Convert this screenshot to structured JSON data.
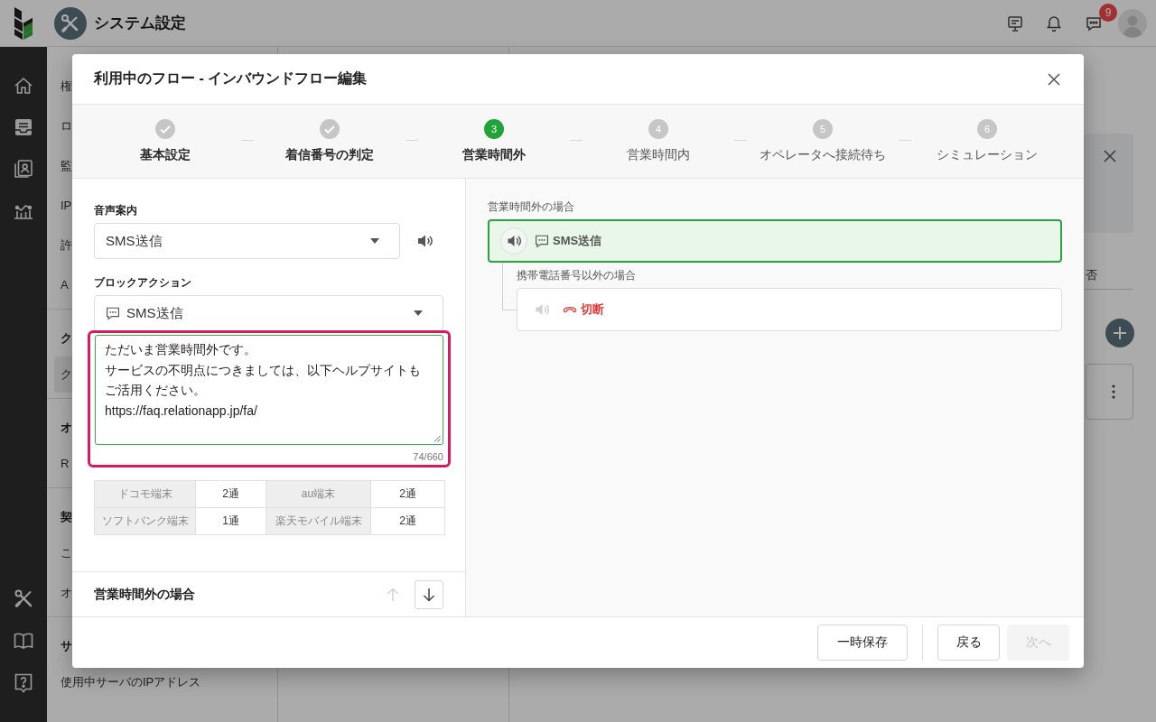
{
  "header": {
    "title": "システム設定",
    "badge": "9"
  },
  "settings_menu": {
    "items": [
      {
        "label": "権",
        "selected": false
      },
      {
        "label": "ロ",
        "selected": false
      },
      {
        "label": "監",
        "selected": false
      },
      {
        "label": "IP",
        "selected": false
      },
      {
        "label": "許",
        "selected": false
      },
      {
        "label": "A",
        "selected": false
      }
    ],
    "groups": [
      {
        "heading": "ク",
        "items": [
          {
            "label": "ク",
            "selected": true
          }
        ]
      },
      {
        "heading": "オ",
        "items": [
          {
            "label": "R",
            "selected": false
          }
        ]
      },
      {
        "heading": "契",
        "items": [
          {
            "label": "こ",
            "selected": false
          },
          {
            "label": "オ",
            "selected": false
          }
        ]
      },
      {
        "heading": "サ",
        "items": [
          {
            "label": "使用中サーバのIPアドレス",
            "selected": false
          }
        ]
      }
    ]
  },
  "background_tab": {
    "label": "否"
  },
  "dialog": {
    "title": "利用中のフロー - インバウンドフロー編集",
    "steps": [
      {
        "label": "基本設定",
        "done": true,
        "selected": false
      },
      {
        "label": "着信番号の判定",
        "done": true,
        "selected": false
      },
      {
        "label": "営業時間外",
        "done": false,
        "selected": true,
        "number": "3"
      },
      {
        "label": "営業時間内",
        "done": false,
        "selected": false,
        "number": "4"
      },
      {
        "label": "オペレータへ接続待ち",
        "done": false,
        "selected": false,
        "number": "5"
      },
      {
        "label": "シミュレーション",
        "done": false,
        "selected": false,
        "number": "6"
      }
    ],
    "form": {
      "voice_label": "音声案内",
      "voice_value": "SMS送信",
      "action_label": "ブロックアクション",
      "action_value": "SMS送信",
      "message_lines": [
        "ただいま営業時間外です。",
        "サービスの不明点につきましては、以下ヘルプサイトもご活用ください。",
        "https://faq.relationapp.jp/fa/"
      ],
      "char_count": "74/660",
      "highlighted": true,
      "carrier_counts": [
        {
          "carrier": "ドコモ端末",
          "count": "2通"
        },
        {
          "carrier": "au端末",
          "count": "2通"
        },
        {
          "carrier": "ソフトバンク端末",
          "count": "1通"
        },
        {
          "carrier": "楽天モバイル端末",
          "count": "2通"
        }
      ],
      "section": {
        "title": "営業時間外の場合",
        "controls": [
          {
            "kind": "up",
            "disabled": true
          },
          {
            "kind": "down",
            "disabled": false
          }
        ]
      }
    },
    "flow": {
      "label": "営業時間外の場合",
      "node": {
        "kind": "sms",
        "label": "SMS送信",
        "selected": true
      },
      "branches": [
        {
          "label": "携帯電話番号以外の場合",
          "node": {
            "kind": "hangup",
            "label": "切断",
            "selected": false
          }
        }
      ]
    },
    "buttons": [
      {
        "label": "一時保存",
        "disabled": false
      },
      {
        "label": "戻る",
        "disabled": false
      },
      {
        "label": "次へ",
        "disabled": true
      }
    ]
  }
}
